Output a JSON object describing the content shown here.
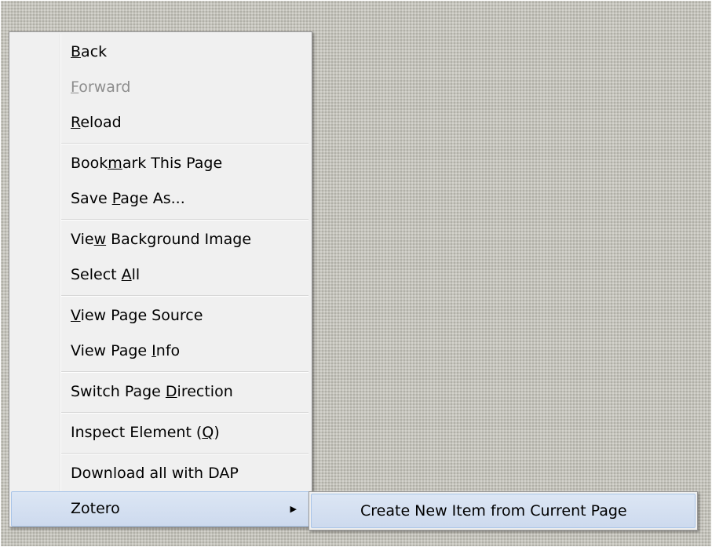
{
  "context_menu": {
    "items": [
      {
        "pre": "",
        "key": "B",
        "post": "ack"
      },
      {
        "pre": "",
        "key": "F",
        "post": "orward"
      },
      {
        "pre": "",
        "key": "R",
        "post": "eload"
      },
      {
        "pre": "Book",
        "key": "m",
        "post": "ark This Page"
      },
      {
        "pre": "Save ",
        "key": "P",
        "post": "age As..."
      },
      {
        "pre": "Vie",
        "key": "w",
        "post": " Background Image"
      },
      {
        "pre": "Select ",
        "key": "A",
        "post": "ll"
      },
      {
        "pre": "",
        "key": "V",
        "post": "iew Page Source"
      },
      {
        "pre": "View Page ",
        "key": "I",
        "post": "nfo"
      },
      {
        "pre": "Switch Page ",
        "key": "D",
        "post": "irection"
      },
      {
        "pre": "Inspect Element (",
        "key": "Q",
        "post": ")"
      },
      {
        "pre": "Download all with DAP",
        "key": "",
        "post": ""
      },
      {
        "pre": "Zotero",
        "key": "",
        "post": ""
      }
    ],
    "submenu_arrow": "▶"
  },
  "zotero_submenu": {
    "items": [
      {
        "label": "Create New Item from Current Page"
      }
    ]
  }
}
